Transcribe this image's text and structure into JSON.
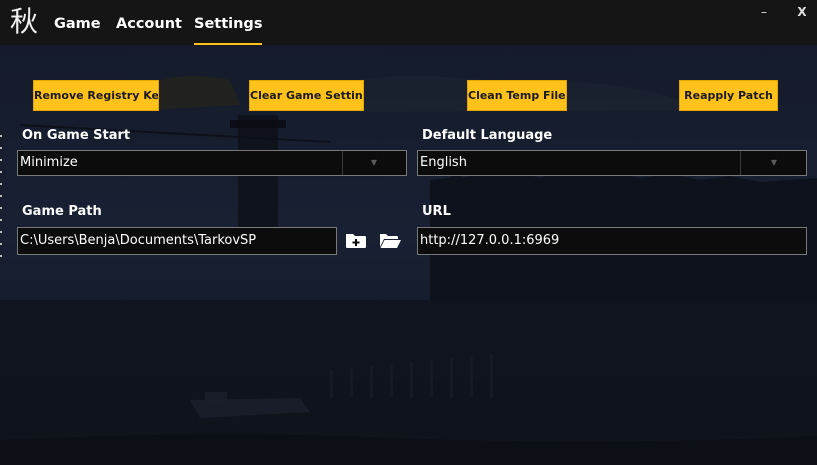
{
  "app": {
    "logo_char": "秋"
  },
  "nav": {
    "tabs": [
      {
        "label": "Game"
      },
      {
        "label": "Account"
      },
      {
        "label": "Settings"
      }
    ],
    "active_tab": "Settings"
  },
  "window_controls": {
    "minimize": "–",
    "close": "X"
  },
  "actions": {
    "remove_registry_keys": "Remove Registry Keys",
    "clear_game_settings": "Clear Game Settings",
    "clean_temp_files": "Clean Temp Files",
    "reapply_patch": "Reapply Patch"
  },
  "settings": {
    "on_game_start": {
      "label": "On Game Start",
      "value": "Minimize"
    },
    "default_language": {
      "label": "Default Language",
      "value": "English"
    },
    "game_path": {
      "label": "Game Path",
      "value": "C:\\Users\\Benja\\Documents\\TarkovSP"
    },
    "url": {
      "label": "URL",
      "value": "http://127.0.0.1:6969"
    }
  },
  "icons": {
    "add_folder": "folder-plus-icon",
    "open_folder": "folder-open-icon",
    "dropdown": "chevron-down-icon"
  },
  "colors": {
    "accent": "#ffc21a",
    "titlebar": "#151515",
    "input_bg": "#0c0c0c",
    "input_border": "#7a7a7a"
  }
}
